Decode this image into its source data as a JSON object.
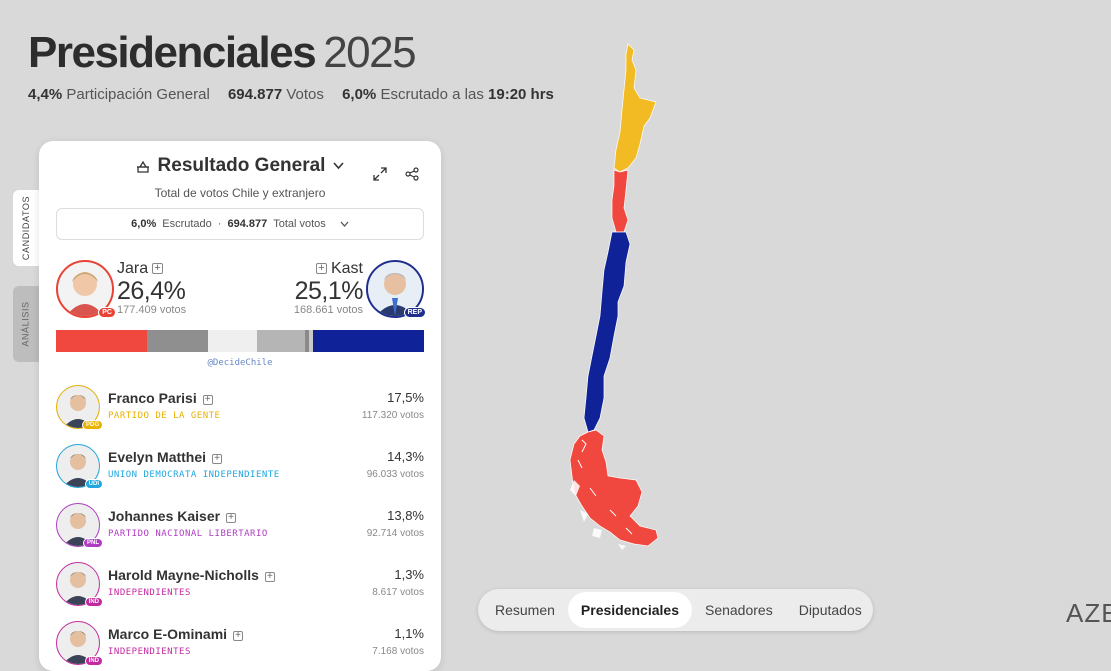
{
  "header": {
    "title_bold": "Presidenciales",
    "title_year": "2025",
    "participation_value": "4,4%",
    "participation_label": "Participación General",
    "votes_value": "694.877",
    "votes_label": "Votos",
    "counted_value": "6,0%",
    "counted_label": "Escrutado a las",
    "counted_time": "19:20 hrs"
  },
  "sidetabs": [
    "CANDIDATOS",
    "ANÁLISIS"
  ],
  "panel": {
    "title": "Resultado General",
    "subtitle": "Total de votos Chile y extranjero",
    "summary_counted_value": "6,0%",
    "summary_counted_label": "Escrutado",
    "summary_separator": "·",
    "summary_votes_value": "694.877",
    "summary_votes_label": "Total votos",
    "handle": "@DecideChile"
  },
  "top_candidates": {
    "left": {
      "name": "Jara",
      "pct": "26,4%",
      "votes": "177.409 votos",
      "party": "PC",
      "color": "#ea4335"
    },
    "right": {
      "name": "Kast",
      "pct": "25,1%",
      "votes": "168.661 votos",
      "party": "REP",
      "color": "#1f2f8f"
    }
  },
  "result_bar": {
    "segments": [
      {
        "pct": 26.4,
        "color": "#f0483e"
      },
      {
        "pct": 17.5,
        "color": "#8f8f8f"
      },
      {
        "pct": 14.3,
        "color": "#efefef"
      },
      {
        "pct": 13.8,
        "color": "#b5b5b5"
      },
      {
        "pct": 1.3,
        "color": "#8a8a8a"
      },
      {
        "pct": 1.1,
        "color": "#c9c9c9"
      },
      {
        "pct": 32.0,
        "color": "#0f2297"
      }
    ]
  },
  "candidates": [
    {
      "name": "Franco Parisi",
      "party": "PARTIDO DE LA GENTE",
      "party_color": "#e9b100",
      "badge": "PDG",
      "pct": "17,5%",
      "votes": "117.320 votos"
    },
    {
      "name": "Evelyn Matthei",
      "party": "UNION DEMOCRATA INDEPENDIENTE",
      "party_color": "#1ea7e0",
      "badge": "UDI",
      "pct": "14,3%",
      "votes": "96.033 votos"
    },
    {
      "name": "Johannes Kaiser",
      "party": "PARTIDO NACIONAL LIBERTARIO",
      "party_color": "#b03cc4",
      "badge": "PNL",
      "pct": "13,8%",
      "votes": "92.714 votos"
    },
    {
      "name": "Harold Mayne-Nicholls",
      "party": "INDEPENDIENTES",
      "party_color": "#c42aa0",
      "badge": "IND",
      "pct": "1,3%",
      "votes": "8.617 votos"
    },
    {
      "name": "Marco E-Ominami",
      "party": "INDEPENDIENTES",
      "party_color": "#c42aa0",
      "badge": "IND",
      "pct": "1,1%",
      "votes": "7.168 votos"
    }
  ],
  "tabs": {
    "items": [
      "Resumen",
      "Presidenciales",
      "Senadores",
      "Diputados"
    ],
    "active": "Presidenciales"
  },
  "brand": "AZE",
  "icons": {
    "title": "ballot-box-icon",
    "expand": "expand-icon",
    "share": "share-icon",
    "dropdown": "chevron-down-icon"
  }
}
